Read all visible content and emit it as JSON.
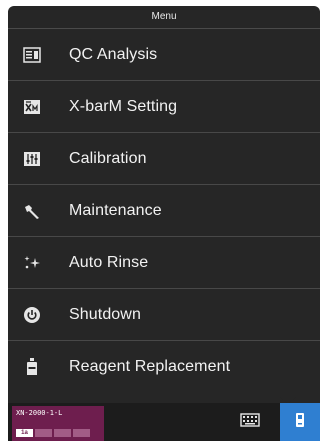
{
  "menu": {
    "title": "Menu",
    "items": [
      {
        "label": "QC Analysis",
        "icon": "qc-analysis-icon"
      },
      {
        "label": "X-barM Setting",
        "icon": "xbarm-icon"
      },
      {
        "label": "Calibration",
        "icon": "calibration-icon"
      },
      {
        "label": "Maintenance",
        "icon": "wrench-icon"
      },
      {
        "label": "Auto Rinse",
        "icon": "sparkle-icon"
      },
      {
        "label": "Shutdown",
        "icon": "power-icon"
      },
      {
        "label": "Reagent Replacement",
        "icon": "reagent-bottle-icon"
      }
    ]
  },
  "statusbar": {
    "analyzer_name": "XN-2000-1-L",
    "active_slot_label": "1a",
    "accent_color": "#2f7fd1",
    "analyzer_color": "#6e1e4e"
  }
}
